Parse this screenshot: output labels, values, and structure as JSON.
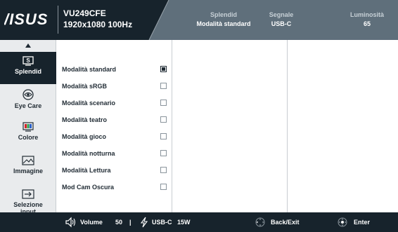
{
  "header": {
    "model": "VU249CFE",
    "resolution": "1920x1080 100Hz",
    "stats": [
      {
        "label": "Splendid",
        "value": "Modalità standard"
      },
      {
        "label": "Segnale",
        "value": "USB-C"
      },
      {
        "label": "Luminosità",
        "value": "65"
      }
    ]
  },
  "sidebar": {
    "items": [
      {
        "label": "Splendid",
        "icon": "splendid-icon",
        "active": true
      },
      {
        "label": "Eye Care",
        "icon": "eye-care-icon",
        "active": false
      },
      {
        "label": "Colore",
        "icon": "color-icon",
        "active": false
      },
      {
        "label": "Immagine",
        "icon": "image-icon",
        "active": false
      },
      {
        "label": "Selezione input",
        "label_line1": "Selezione",
        "label_line2": "input",
        "icon": "input-select-icon",
        "active": false
      }
    ]
  },
  "options": [
    {
      "label": "Modalità standard",
      "selected": true
    },
    {
      "label": "Modalità sRGB",
      "selected": false
    },
    {
      "label": "Modalità scenario",
      "selected": false
    },
    {
      "label": "Modalità teatro",
      "selected": false
    },
    {
      "label": "Modalità gioco",
      "selected": false
    },
    {
      "label": "Modalità notturna",
      "selected": false
    },
    {
      "label": "Modalità Lettura",
      "selected": false
    },
    {
      "label": "Mod Cam Oscura",
      "selected": false
    }
  ],
  "footer": {
    "volume_label": "Volume",
    "volume_value": "50",
    "divider": "|",
    "source_label": "USB-C",
    "power_value": "15W",
    "back_label": "Back/Exit",
    "enter_label": "Enter"
  },
  "colors": {
    "header_bg": "#5f6f7b",
    "header_dark": "#17232c",
    "sidebar_bg": "#e9ebed",
    "active_bg": "#17232c",
    "footer_bg": "#17232c"
  }
}
